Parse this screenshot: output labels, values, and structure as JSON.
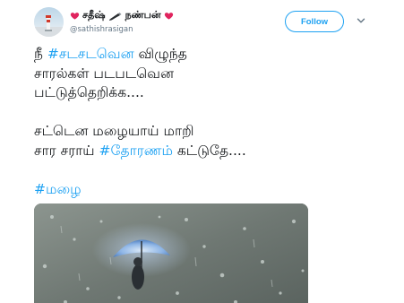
{
  "user": {
    "display_name": "சதீஷ் நண்பன்",
    "display_name_part1": "சதீஷ்",
    "display_name_part2": "நண்பன்",
    "handle": "@sathishrasigan"
  },
  "follow_button": {
    "label": "Follow"
  },
  "tweet": {
    "line1_prefix": "நீ ",
    "line1_hashtag": "#சடசடவென",
    "line1_suffix": " விழுந்த",
    "line2": "சாரல்கள் படபடவென",
    "line3": "பட்டுத்தெறிக்க....",
    "line4": "சட்டென மழையாய் மாறி",
    "line5_prefix": "சார சராய் ",
    "line5_hashtag": "#தோரணம்",
    "line5_suffix": " கட்டுதே....",
    "line6_hashtag": "#மழை"
  },
  "icons": {
    "heart_color": "#e0245e",
    "link_color": "#1da1f2",
    "caret": "chevron-down-icon"
  }
}
